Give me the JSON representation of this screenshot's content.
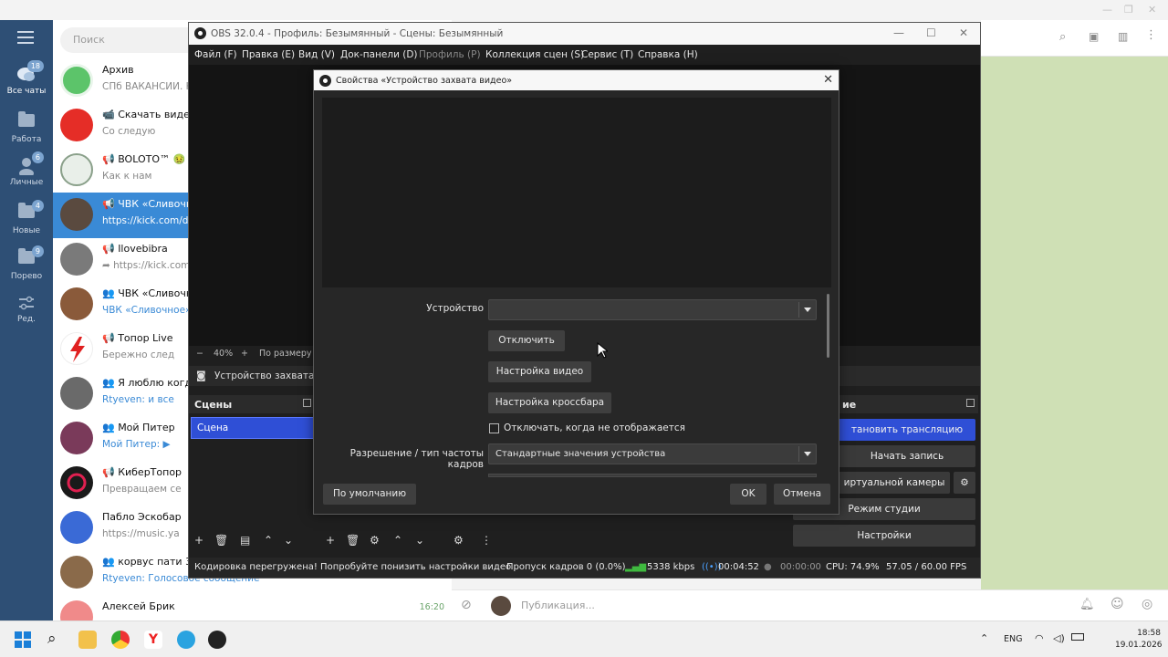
{
  "telegram": {
    "search_placeholder": "Поиск",
    "rail": [
      {
        "label": "Все чаты",
        "badge": "18",
        "icon": "chat-bubbles-icon"
      },
      {
        "label": "Работа",
        "badge": "",
        "icon": "folder-icon"
      },
      {
        "label": "Личные",
        "badge": "6",
        "icon": "person-icon"
      },
      {
        "label": "Новые",
        "badge": "4",
        "icon": "folder-icon"
      },
      {
        "label": "Порево",
        "badge": "9",
        "icon": "folder-icon"
      },
      {
        "label": "Ред.",
        "badge": "",
        "icon": "sliders-icon"
      }
    ],
    "chats": [
      {
        "name": "Архив",
        "msg": "СПб ВАКАНСИИ. Н",
        "time": ""
      },
      {
        "name": "📹 Скачать видео",
        "msg": "Со следую",
        "time": ""
      },
      {
        "name": "📢 BOLOTO™ 🤢",
        "msg": "Как к нам",
        "time": ""
      },
      {
        "name": "📢 ЧВК «Сливочн",
        "msg": "https://kick.com/da",
        "time": ""
      },
      {
        "name": "📢 Ilovebibra",
        "msg": "➦ https://kick.com",
        "time": ""
      },
      {
        "name": "👥 ЧВК «Сливочн",
        "msg": "ЧВК «Сливочное»:",
        "time": ""
      },
      {
        "name": "📢 Топор Live",
        "msg": "Бережно след",
        "time": ""
      },
      {
        "name": "👥 Я люблю когда",
        "msg": "Rtyeven: и все",
        "time": ""
      },
      {
        "name": "👥 Мой Питер",
        "msg": "Мой Питер: ▶",
        "time": ""
      },
      {
        "name": "📢 КиберТопор",
        "msg": "Превращаем се",
        "time": ""
      },
      {
        "name": "Пабло Эскобар",
        "msg": "https://music.ya",
        "time": ""
      },
      {
        "name": "👥 корвус пати 3.0",
        "msg": "Rtyeven: Голосовое сообщение",
        "time": ""
      },
      {
        "name": "Алексей Брик",
        "msg": "",
        "time": "16:20"
      }
    ],
    "compose_placeholder": "Публикация..."
  },
  "obs": {
    "title": "OBS 32.0.4 - Профиль: Безымянный - Сцены: Безымянный",
    "menu": [
      "Файл (F)",
      "Правка (E)",
      "Вид (V)",
      "Док-панели (D)",
      "Профиль (P)",
      "Коллекция сцен (S)",
      "Сервис (T)",
      "Справка (H)"
    ],
    "zoom": {
      "minus": "−",
      "value": "40%",
      "plus": "+",
      "fit": "По размеру ок"
    },
    "source_name": "Устройство захвата ви",
    "scenes_title": "Сцены",
    "scene_item": "Сцена",
    "controls_title": "ие",
    "controls": {
      "stream": "тановить трансляцию",
      "record": "Начать запись",
      "virtual_cam": "иртуальной камеры",
      "studio": "Режим студии",
      "settings": "Настройки"
    },
    "status": {
      "warning": "Кодировка перегружена! Попробуйте понизить настройки видео",
      "dropped": "Пропуск кадров 0 (0.0%)",
      "bitrate": "5338 kbps",
      "stream_time": "00:04:52",
      "rec_time": "00:00:00",
      "cpu": "CPU: 74.9%",
      "fps": "57.05 / 60.00 FPS"
    }
  },
  "dialog": {
    "title": "Свойства «Устройство захвата видео»",
    "device_label": "Устройство",
    "device_value": "",
    "btn_disable": "Отключить",
    "btn_video": "Настройка видео",
    "btn_crossbar": "Настройка кроссбара",
    "checkbox_label": "Отключать, когда не отображается",
    "resolution_label": "Разрешение / тип частоты кадров",
    "resolution_value": "Стандартные значения устройства",
    "btn_defaults": "По умолчанию",
    "btn_ok": "OK",
    "btn_cancel": "Отмена"
  },
  "taskbar": {
    "lang": "ENG",
    "time": "18:58",
    "date": "19.01.2026"
  }
}
